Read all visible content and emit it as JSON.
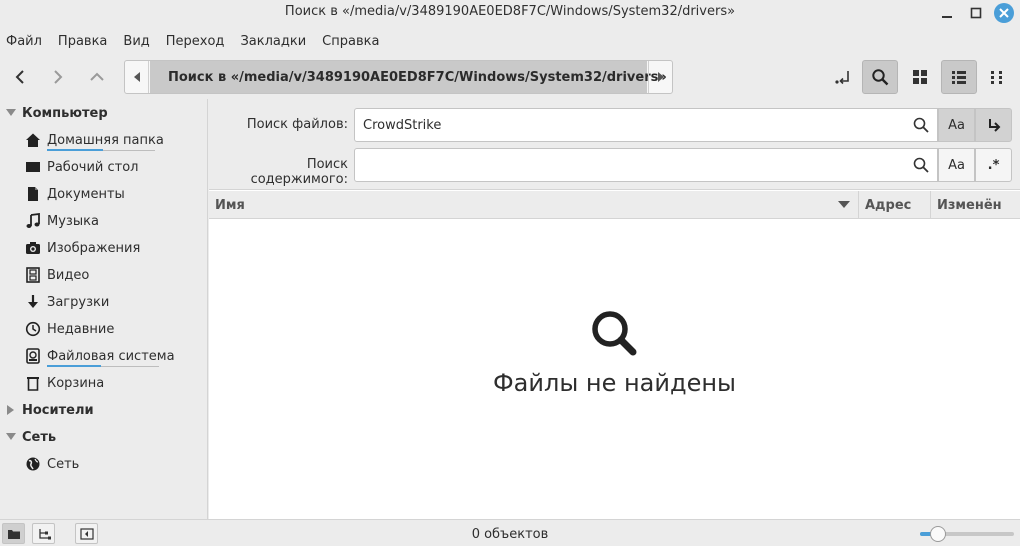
{
  "window": {
    "title": "Поиск в «/media/v/3489190AE0ED8F7C/Windows/System32/drivers»",
    "accent_color": "#4a9ed8"
  },
  "menubar": {
    "items": [
      "Файл",
      "Правка",
      "Вид",
      "Переход",
      "Закладки",
      "Справка"
    ]
  },
  "toolbar": {
    "path_text": "Поиск в «/media/v/3489190AE0ED8F7C/Windows/System32/drivers»",
    "icons": [
      "back-icon",
      "forward-icon",
      "up-icon",
      "path-left-icon",
      "search-icon",
      "path-right-icon",
      "open-terminal-icon",
      "search-toggle-icon",
      "icon-view-icon",
      "list-view-icon",
      "compact-view-icon"
    ]
  },
  "sidebar": {
    "sections": [
      {
        "title": "Компьютер",
        "items": [
          {
            "label": "Домашняя папка",
            "icon": "home-icon"
          },
          {
            "label": "Рабочий стол",
            "icon": "desktop-icon"
          },
          {
            "label": "Документы",
            "icon": "document-icon"
          },
          {
            "label": "Музыка",
            "icon": "music-icon"
          },
          {
            "label": "Изображения",
            "icon": "camera-icon"
          },
          {
            "label": "Видео",
            "icon": "film-icon"
          },
          {
            "label": "Загрузки",
            "icon": "download-icon"
          },
          {
            "label": "Недавние",
            "icon": "clock-icon"
          },
          {
            "label": "Файловая система",
            "icon": "drive-icon"
          },
          {
            "label": "Корзина",
            "icon": "trash-icon"
          }
        ]
      },
      {
        "title": "Носители",
        "items": []
      },
      {
        "title": "Сеть",
        "items": [
          {
            "label": "Сеть",
            "icon": "network-icon"
          }
        ]
      }
    ]
  },
  "search": {
    "files_label": "Поиск файлов:",
    "files_value": "CrowdStrike",
    "content_label": "Поиск содержимого:",
    "content_value": "",
    "case_button": "Aa",
    "recursive_icon": "recursive-icon",
    "regex_button": ".*"
  },
  "columns": {
    "name": "Имя",
    "address": "Адрес",
    "modified": "Изменён"
  },
  "empty_state": {
    "message": "Файлы не найдены"
  },
  "statusbar": {
    "status": "0 объектов",
    "zoom_level": 0.19
  }
}
